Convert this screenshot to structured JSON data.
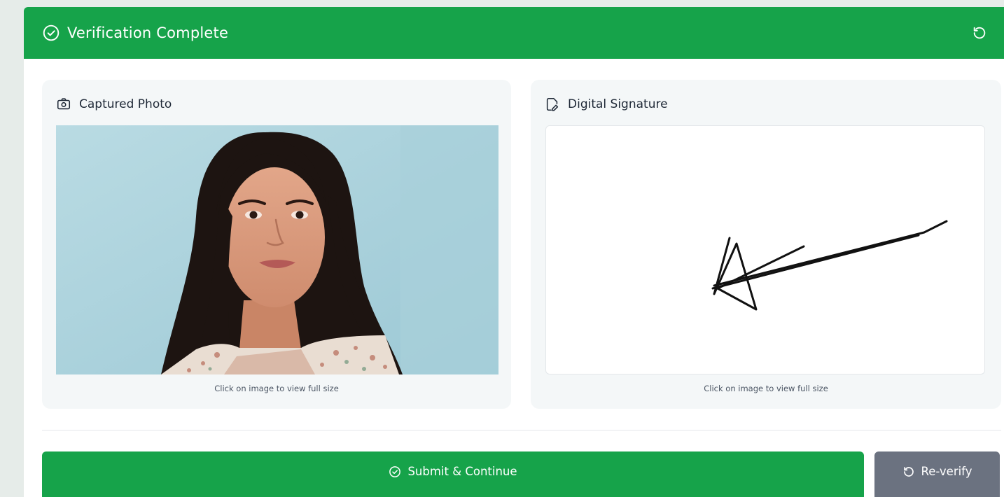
{
  "header": {
    "title": "Verification Complete",
    "title_icon": "check-circle-icon",
    "refresh_icon": "refresh-icon",
    "color": "#16a34a"
  },
  "photo_panel": {
    "title": "Captured Photo",
    "icon": "camera-icon",
    "hint": "Click on image to view full size"
  },
  "signature_panel": {
    "title": "Digital Signature",
    "icon": "signature-pen-icon",
    "hint": "Click on image to view full size"
  },
  "actions": {
    "submit_label": "Submit & Continue",
    "submit_icon": "check-circle-icon",
    "submit_color": "#16a34a",
    "reverify_label": "Re-verify",
    "reverify_icon": "refresh-icon",
    "reverify_color": "#6b7280"
  }
}
